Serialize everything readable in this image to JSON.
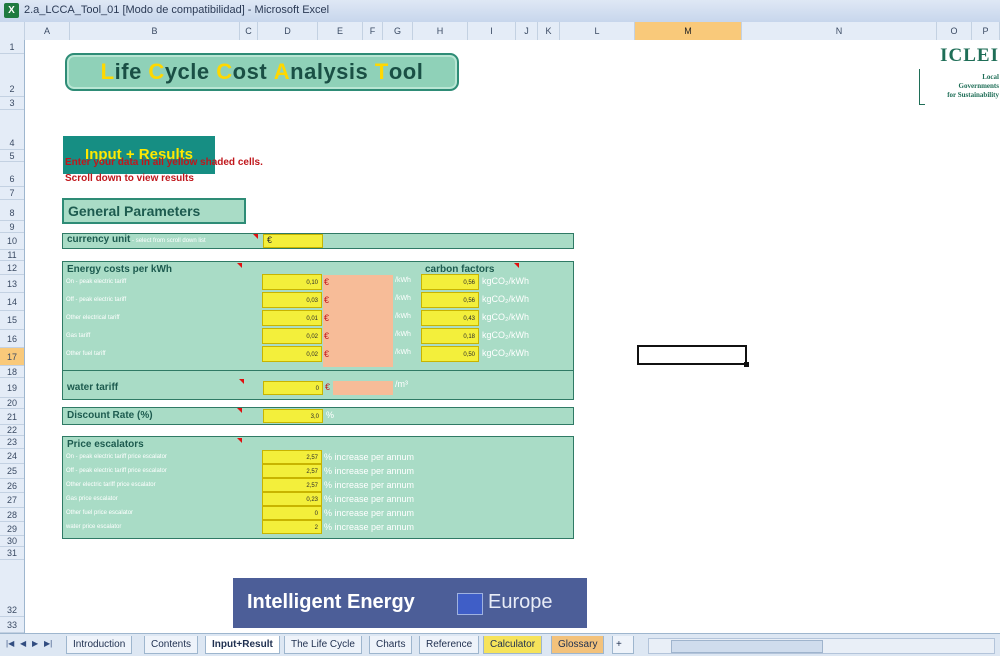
{
  "window": {
    "title": "2.a_LCCA_Tool_01  [Modo de compatibilidad] - Microsoft Excel",
    "app_icon": "excel-icon"
  },
  "columns": [
    "A",
    "B",
    "C",
    "D",
    "E",
    "F",
    "G",
    "H",
    "I",
    "J",
    "K",
    "L",
    "M",
    "N",
    "O",
    "P"
  ],
  "selected_column": "M",
  "rows": [
    "1",
    "2",
    "3",
    "4",
    "5",
    "6",
    "7",
    "8",
    "9",
    "10",
    "11",
    "12",
    "13",
    "14",
    "15",
    "16",
    "17",
    "18",
    "19",
    "20",
    "21",
    "22",
    "23",
    "24",
    "25",
    "26",
    "27",
    "28",
    "29",
    "30",
    "31",
    "32",
    "33"
  ],
  "selected_row": "17",
  "sheet": {
    "banner": {
      "L": "L",
      "part1": "ife ",
      "C1": "C",
      "part2": "ycle ",
      "C2": "C",
      "part3": "ost ",
      "A": "A",
      "part4": "nalysis ",
      "T": "T",
      "part5": "ool"
    },
    "logo": {
      "name": "ICLEI",
      "line1": "Local",
      "line2": "Governments",
      "line3": "for Sustainability"
    },
    "section_title": "Input + Results",
    "notes": [
      "Enter your data in all yellow shaded cells.",
      "Scroll down to view results"
    ],
    "general_parameters": "General Parameters",
    "currency": {
      "label": "currency unit",
      "hint": " - select from scroll down list",
      "value": "€"
    },
    "energy": {
      "header": "Energy costs per kWh",
      "carbon_header": "carbon factors",
      "rows": [
        {
          "label": "On - peak electric tariff",
          "value": "0,10",
          "cur": "€",
          "unit": "/kWh",
          "carbon": "0,56",
          "cunit": "kgCO₂/kWh"
        },
        {
          "label": "Off - peak electric tariff",
          "value": "0,03",
          "cur": "€",
          "unit": "/kWh",
          "carbon": "0,56",
          "cunit": "kgCO₂/kWh"
        },
        {
          "label": "Other electrical tariff",
          "value": "0,01",
          "cur": "€",
          "unit": "/kWh",
          "carbon": "0,43",
          "cunit": "kgCO₂/kWh"
        },
        {
          "label": "Gas tariff",
          "value": "0,02",
          "cur": "€",
          "unit": "/kWh",
          "carbon": "0,18",
          "cunit": "kgCO₂/kWh"
        },
        {
          "label": "Other fuel tariff",
          "value": "0,02",
          "cur": "€",
          "unit": "/kWh",
          "carbon": "0,50",
          "cunit": "kgCO₂/kWh"
        }
      ]
    },
    "water": {
      "label": "water tariff",
      "value": "0",
      "cur": "€",
      "unit": "/m³"
    },
    "discount": {
      "label": "Discount Rate (%)",
      "value": "3,0",
      "unit": "%"
    },
    "escalators": {
      "header": "Price escalators",
      "unit": "% increase per annum",
      "rows": [
        {
          "label": "On - peak electric tariff price escalator",
          "value": "2,57"
        },
        {
          "label": "Off - peak electric tariff price escalator",
          "value": "2,57"
        },
        {
          "label": "Other electric tariff price escalator",
          "value": "2,57"
        },
        {
          "label": "Gas price escalator",
          "value": "0,23"
        },
        {
          "label": "Other fuel price escalator",
          "value": "0"
        },
        {
          "label": "water price escalator",
          "value": "2"
        }
      ]
    },
    "ie_banner": {
      "a": "Intelligent Energy",
      "b": "Europe"
    }
  },
  "tabs": [
    "Introduction",
    "Contents",
    "Input+Result",
    "The Life Cycle",
    "Charts",
    "Reference",
    "Calculator",
    "Glossary"
  ],
  "active_tab": "Input+Result",
  "colors": {
    "accent": "#168e83",
    "panel": "#a9dcc6",
    "input": "#f3ef3b",
    "salmon": "#f7bc98",
    "title_yellow": "#ffd800"
  }
}
